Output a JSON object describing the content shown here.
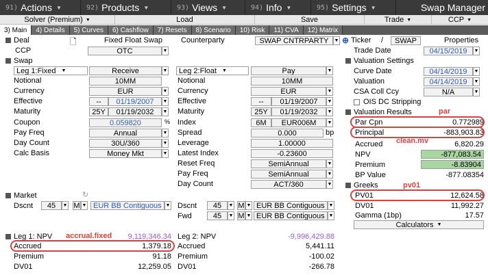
{
  "menubar": {
    "items": [
      {
        "num": "91)",
        "label": "Actions"
      },
      {
        "num": "92)",
        "label": "Products"
      },
      {
        "num": "93)",
        "label": "Views"
      },
      {
        "num": "94)",
        "label": "Info"
      },
      {
        "num": "95)",
        "label": "Settings"
      }
    ],
    "title": "Swap Manager"
  },
  "actionbar": [
    "Solver (Premium)",
    "Load",
    "Save",
    "Trade",
    "CCP"
  ],
  "tabs": [
    "3) Main",
    "4) Details",
    "5) Curves",
    "6) Cashflow",
    "7) Resets",
    "8) Scenario",
    "10) Risk",
    "11) CVA",
    "12) Matrix"
  ],
  "deal": {
    "section": "Deal",
    "title": "Fixed Float Swap",
    "counterparty_label": "Counterparty",
    "counterparty": "SWAP CNTRPARTY",
    "ticker_label": "Ticker",
    "ticker_sep": "/",
    "ticker": "SWAP",
    "properties": "Properties",
    "ccp_label": "CCP",
    "ccp": "OTC",
    "trade_date_label": "Trade Date",
    "trade_date": "04/15/2019"
  },
  "swap": {
    "section": "Swap",
    "leg1": {
      "header": "Leg 1:Fixed",
      "side": "Receive",
      "rows": [
        {
          "label": "Notional",
          "value": "10MM"
        },
        {
          "label": "Currency",
          "value": "EUR"
        },
        {
          "label": "Effective",
          "prefix": "--",
          "value": "01/19/2007"
        },
        {
          "label": "Maturity",
          "prefix": "25Y",
          "value": "01/19/2032"
        },
        {
          "label": "Coupon",
          "value": "0.059820",
          "unit": "%"
        },
        {
          "label": "Pay Freq",
          "value": "Annual"
        },
        {
          "label": "Day Count",
          "value": "30U/360"
        },
        {
          "label": "Calc Basis",
          "value": "Money Mkt"
        }
      ]
    },
    "leg2": {
      "header": "Leg 2:Float",
      "side": "Pay",
      "rows": [
        {
          "label": "Notional",
          "value": "10MM"
        },
        {
          "label": "Currency",
          "value": "EUR"
        },
        {
          "label": "Effective",
          "prefix": "--",
          "value": "01/19/2007"
        },
        {
          "label": "Maturity",
          "prefix": "25Y",
          "value": "01/19/2032"
        },
        {
          "label": "Index",
          "prefix": "6M",
          "value": "EUR006M"
        },
        {
          "label": "Spread",
          "value": "0.000",
          "unit": "bp"
        },
        {
          "label": "Leverage",
          "value": "1.00000"
        },
        {
          "label": "Latest Index",
          "value": "-0.23600"
        },
        {
          "label": "Reset Freq",
          "value": "SemiAnnual"
        },
        {
          "label": "Pay Freq",
          "value": "SemiAnnual"
        },
        {
          "label": "Day Count",
          "value": "ACT/360"
        }
      ]
    }
  },
  "valuation_settings": {
    "section": "Valuation Settings",
    "curve_date_label": "Curve Date",
    "curve_date": "04/14/2019",
    "valuation_label": "Valuation",
    "valuation": "04/14/2019",
    "csa_label": "CSA Coll Ccy",
    "csa": "N/A",
    "ois_label": "OIS DC Stripping"
  },
  "valuation_results": {
    "section": "Valuation Results",
    "rows": [
      {
        "label": "Par Cpn",
        "value": "0.772989"
      },
      {
        "label": "Principal",
        "value": "-883,903.83"
      },
      {
        "label": "Accrued",
        "value": "6,820.29"
      },
      {
        "label": "NPV",
        "value": "-877,083.54"
      },
      {
        "label": "Premium",
        "value": "-8.83904"
      },
      {
        "label": "BP Value",
        "value": "-877.08354"
      }
    ]
  },
  "greeks": {
    "section": "Greeks",
    "rows": [
      {
        "label": "PV01",
        "value": "12,624.58"
      },
      {
        "label": "DV01",
        "value": "11,992.27"
      },
      {
        "label": "Gamma (1bp)",
        "value": "17.57"
      }
    ],
    "calculators": "Calculators"
  },
  "market": {
    "section": "Market",
    "dscnt_label": "Dscnt",
    "fwd_label": "Fwd",
    "leg1_dscnt": {
      "num": "45",
      "m": "M",
      "curve": "EUR BB Contiguous"
    },
    "leg2_dscnt": {
      "num": "45",
      "m": "M",
      "curve": "EUR BB Contiguous"
    },
    "leg2_fwd": {
      "num": "45",
      "m": "M",
      "curve": "EUR BB Contiguous"
    }
  },
  "leg1_npv": {
    "label": "Leg 1: NPV",
    "value": "9,119,346.34",
    "rows": [
      {
        "label": "Accrued",
        "value": "1,379.18"
      },
      {
        "label": "Premium",
        "value": "91.18"
      },
      {
        "label": "DV01",
        "value": "12,259.05"
      }
    ]
  },
  "leg2_npv": {
    "label": "Leg 2: NPV",
    "value": "-9,996,429.88",
    "rows": [
      {
        "label": "Accrued",
        "value": "5,441.11"
      },
      {
        "label": "Premium",
        "value": "-100.02"
      },
      {
        "label": "DV01",
        "value": "-266.78"
      }
    ]
  },
  "annotations": {
    "par": "par",
    "clean_mv": "clean.mv",
    "pv01": "pv01",
    "accrual_fixed": "accrual.fixed"
  },
  "colors": {
    "menubar": "#3a3a3a",
    "highlight": "#e0403a",
    "blue_value": "#2f5bb7",
    "green_field": "#a8d6a0",
    "purple_value": "#9b59d0"
  }
}
